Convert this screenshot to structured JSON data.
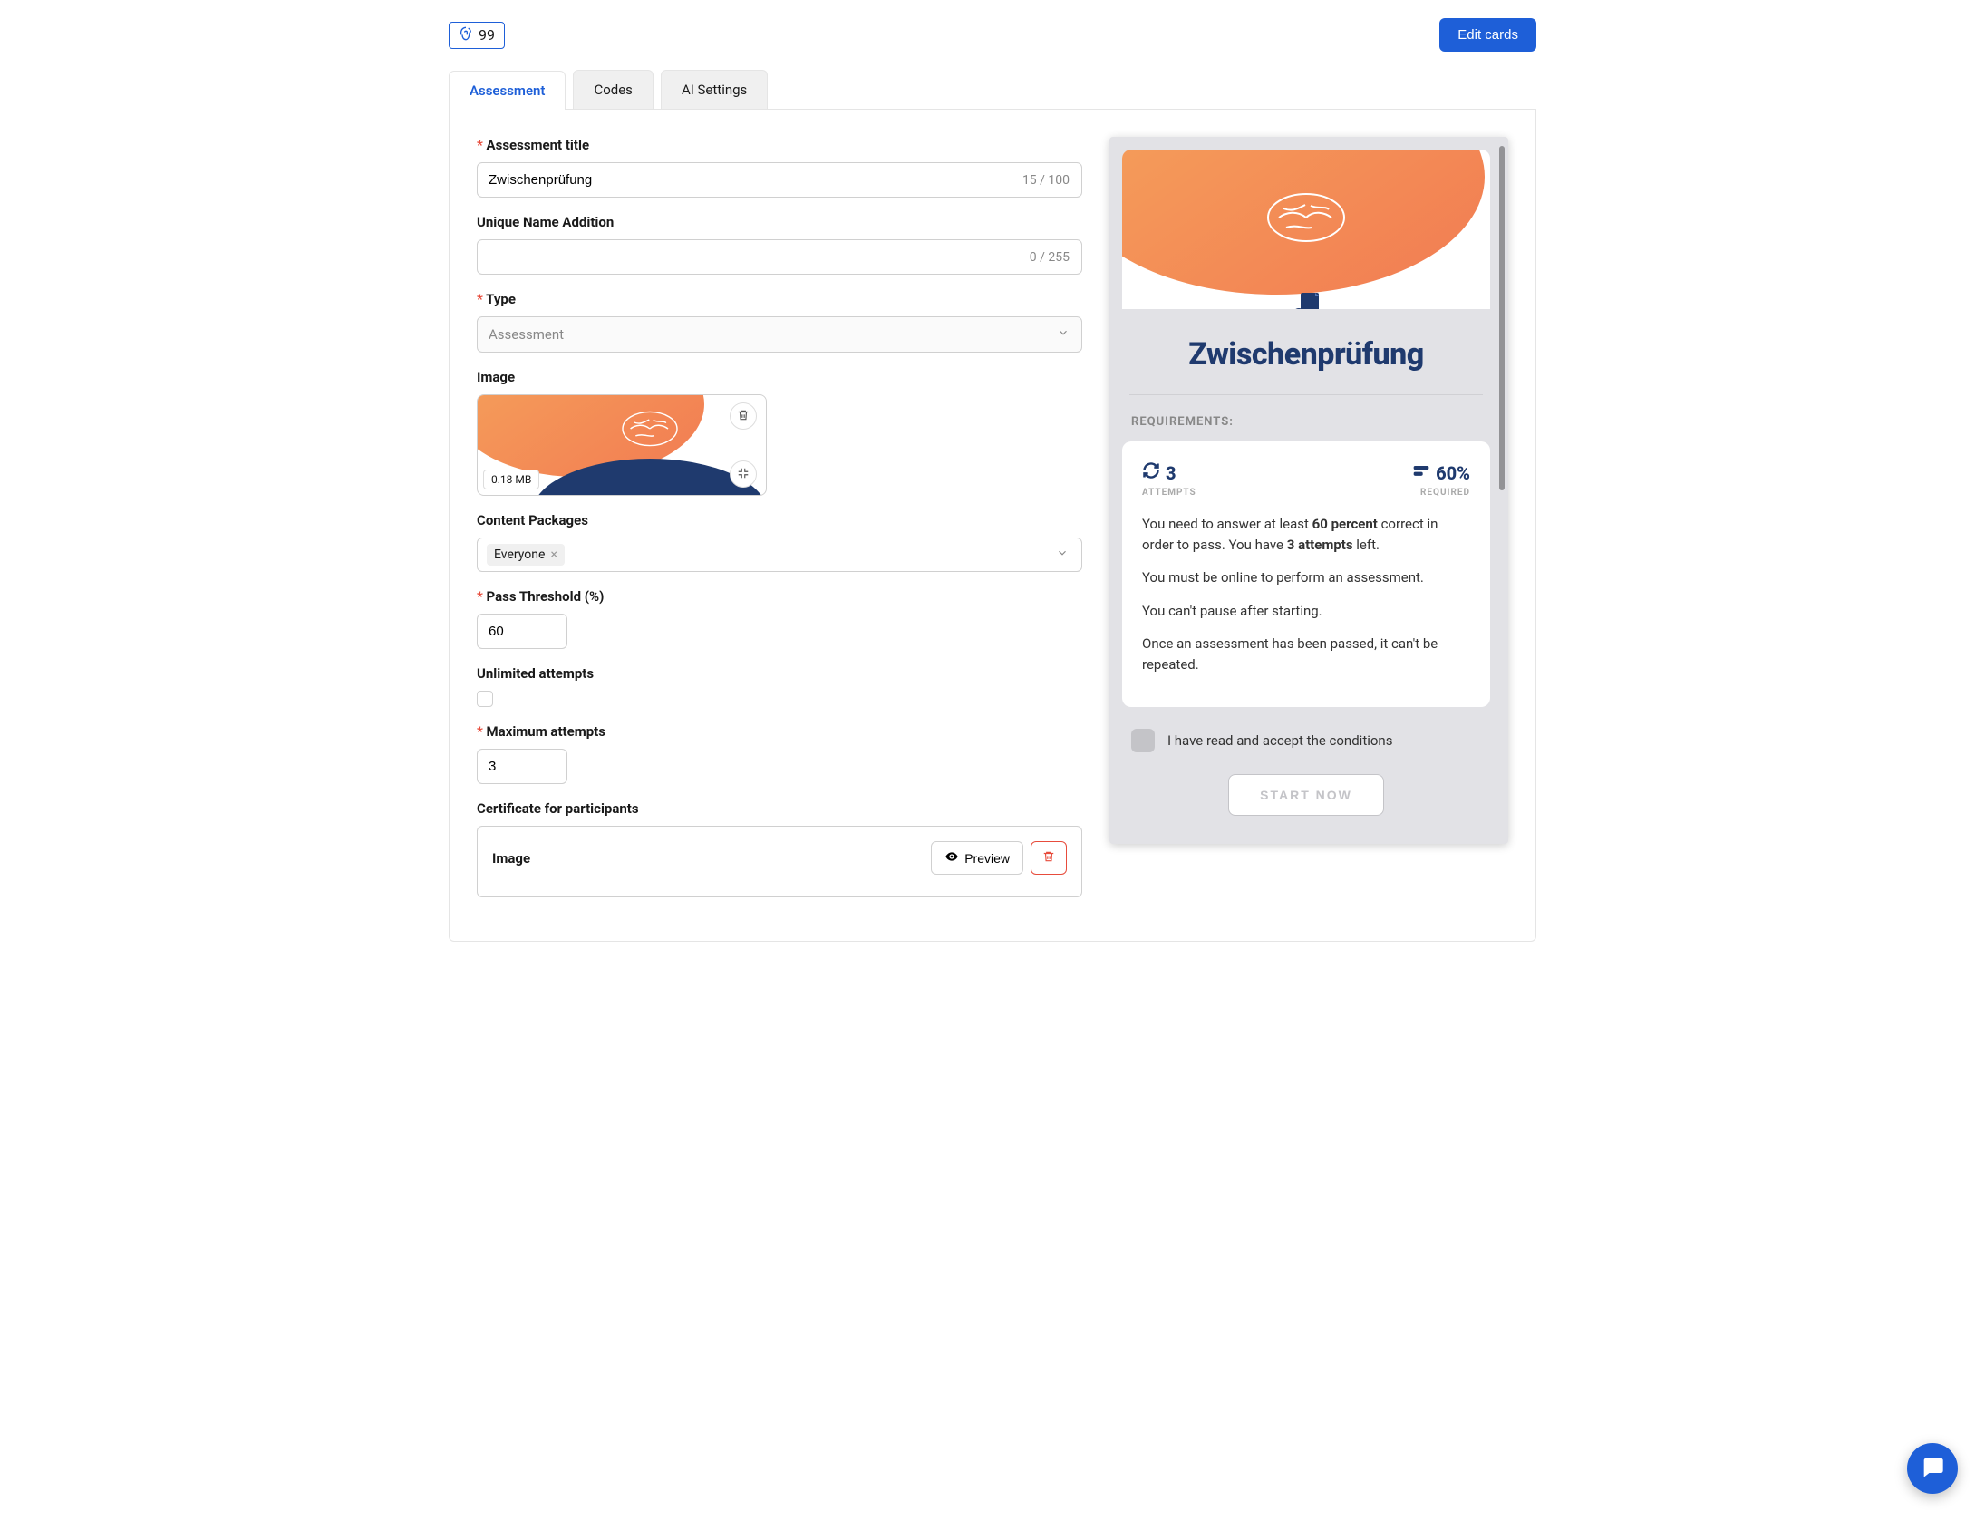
{
  "top": {
    "badge_icon": "fingerprint-icon",
    "badge_value": "99",
    "edit_cards_label": "Edit cards"
  },
  "tabs": {
    "items": [
      {
        "label": "Assessment",
        "active": true
      },
      {
        "label": "Codes",
        "active": false
      },
      {
        "label": "AI Settings",
        "active": false
      }
    ]
  },
  "form": {
    "title_label": "Assessment title",
    "title_value": "Zwischenprüfung",
    "title_counter": "15 / 100",
    "uniquename_label": "Unique Name Addition",
    "uniquename_value": "",
    "uniquename_counter": "0 / 255",
    "type_label": "Type",
    "type_value": "Assessment",
    "image_label": "Image",
    "image_size": "0.18 MB",
    "contentpkg_label": "Content Packages",
    "contentpkg_tag": "Everyone",
    "pass_label": "Pass Threshold (%)",
    "pass_value": "60",
    "unlimited_label": "Unlimited attempts",
    "unlimited_checked": false,
    "max_label": "Maximum attempts",
    "max_value": "3",
    "cert_label": "Certificate for participants",
    "cert_inner_label": "Image",
    "preview_btn_label": "Preview"
  },
  "preview": {
    "title": "Zwischenprüfung",
    "requirements_label": "Requirements:",
    "attempts_value": "3",
    "attempts_label": "Attempts",
    "required_value": "60%",
    "required_label": "Required",
    "line1_pre": "You need to answer at least ",
    "line1_bold": "60 percent",
    "line1_mid": " correct in order to pass. You have ",
    "line1_bold2": "3 attempts",
    "line1_post": " left.",
    "line2": "You must be online to perform an assessment.",
    "line3": "You can't pause after starting.",
    "line4": "Once an assessment has been passed, it can't be repeated.",
    "consent_text": "I have read and accept the conditions",
    "start_label": "START NOW"
  }
}
